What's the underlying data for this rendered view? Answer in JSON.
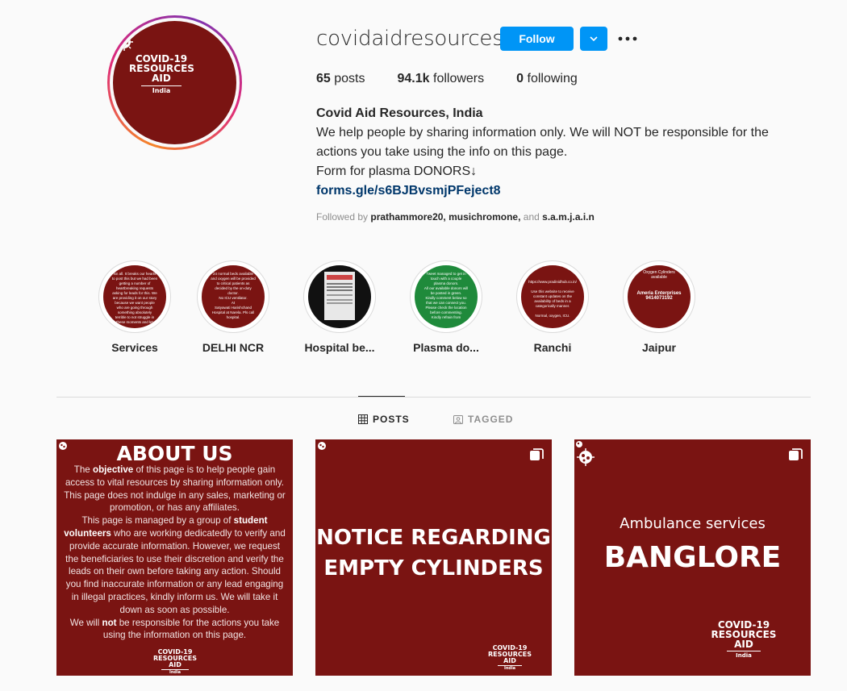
{
  "profile": {
    "username": "covidaidresources",
    "follow_label": "Follow",
    "stats": {
      "posts_count": "65",
      "posts_label": "posts",
      "followers_count": "94.1k",
      "followers_label": "followers",
      "following_count": "0",
      "following_label": "following"
    },
    "full_name": "Covid Aid Resources, India",
    "bio_lines": [
      "We help people by sharing information only. We will NOT be responsible for the",
      "actions you take using the info on this page.",
      "Form for plasma DONORS↓"
    ],
    "link": "forms.gle/s6BJBvsmjPFeject8",
    "followed_by_prefix": "Followed by",
    "followed_by_names": "prathammore20, musichromone,",
    "followed_by_and": "and",
    "followed_by_last": "s.a.m.j.a.i.n"
  },
  "logo": {
    "line1": "COVID-19",
    "line2": "RESOURCES",
    "line3": "AID",
    "line4": "India"
  },
  "highlights": [
    {
      "label": "Services",
      "color": "#7a1412"
    },
    {
      "label": "DELHI NCR",
      "color": "#7a1412"
    },
    {
      "label": "Hospital be...",
      "color": "#111111"
    },
    {
      "label": "Plasma do...",
      "color": "#1f8a3b"
    },
    {
      "label": "Ranchi",
      "color": "#7a1412"
    },
    {
      "label": "Jaipur",
      "color": "#7a1412"
    }
  ],
  "highlight_texts": {
    "h1": [
      "lsn all. It breaks our hearts",
      "to post this but we had been",
      "getting a number of",
      "heartbreaking requests",
      "asking for leads for this. We",
      "are providing it on our story",
      "because we want people",
      "who are going through",
      "something absolutely",
      "terrible to not struggle in",
      "these moments and let",
      "them to their loved"
    ],
    "h2": [
      "24 normal beds available",
      "and oxygen will be provided",
      "to critical patients as",
      "decided by the on-duty",
      "doctor.",
      "No ICU ventilator.",
      "At",
      "Satyawati Harishchand",
      "Hospital at Narela. Pls call",
      "hospital."
    ],
    "h5": [
      "https://www.pradinidhub.co.in/",
      "Use this website to receive",
      "constant updates on the",
      "availability of beds in a",
      "categorically manner.",
      "Normal, oxygen, ICU."
    ],
    "h6": [
      "Oxygen Cylinders",
      "available",
      "Ameria Enterprises",
      "9414073192"
    ],
    "h4": [
      "Tweet managed to get in",
      "touch with a couple",
      "plasma donors.",
      "All our available donors will",
      "be posted in green.",
      "Kindly comment below so",
      "that we can connect you.",
      "Please check the location",
      "before commenting.",
      "Kindly refrain from"
    ]
  },
  "tabs": {
    "posts": "POSTS",
    "tagged": "TAGGED"
  },
  "posts": {
    "about_title": "ABOUT US",
    "about_parts": {
      "p1a": "The ",
      "p1b": "objective",
      "p1c": " of this page is to help people gain access to vital resources by sharing information only. This page does not indulge in any sales, marketing or promotion, or has any affiliates.",
      "p2a": "This page is managed by a group of ",
      "p2b": "student volunteers",
      "p2c": " who are working dedicatedly to verify and provide accurate information. However, we request the beneficiaries to use their discretion and verify the leads on their own before taking any action. Should you find inaccurate information or any lead engaging in illegal practices, kindly inform us. We will take it down as soon as possible.",
      "p3a": "We will ",
      "p3b": "not",
      "p3c": " be responsible for the actions you take using the information on this page."
    },
    "notice_line1": "NOTICE REGARDING",
    "notice_line2": "EMPTY CYLINDERS",
    "ambulance_sub": "Ambulance services",
    "ambulance_title": "BANGLORE"
  },
  "colors": {
    "accent": "#0095f6",
    "brand_maroon": "#7a1412",
    "link": "#00376b"
  },
  "icons": {
    "dropdown": "chevron-down-icon",
    "more": "more-horizontal-icon",
    "posts_tab": "grid-icon",
    "tagged_tab": "tagged-user-icon",
    "multi": "carousel-multiple-icon",
    "virus": "virus-icon"
  }
}
